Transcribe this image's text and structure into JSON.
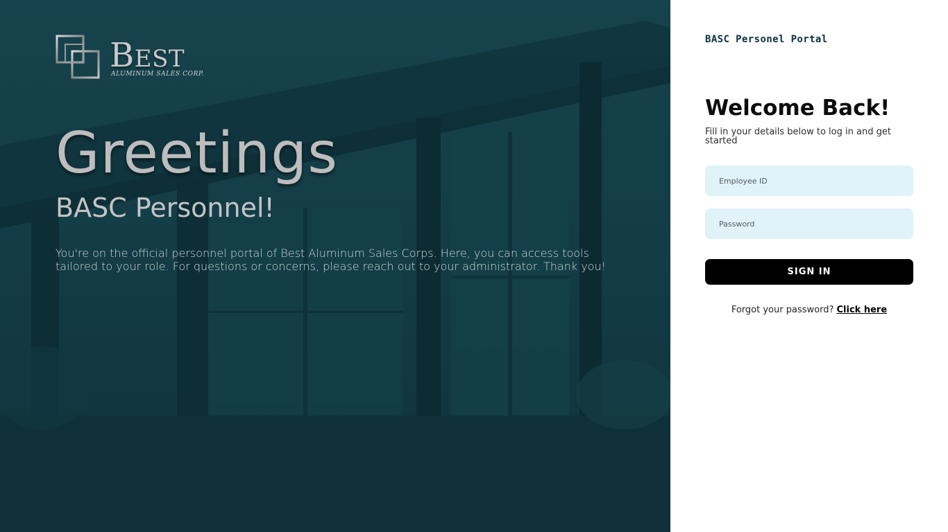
{
  "hero": {
    "logo": {
      "word_first": "B",
      "word_rest": "EST",
      "tagline": "ALUMINUM SALES CORP."
    },
    "greeting": "Greetings",
    "subgreeting": "BASC Personnel!",
    "intro": "You're on the official personnel portal of Best Aluminum Sales Corps. Here, you can access tools tailored to your role. For questions or concerns, please reach out to your administrator. Thank you!"
  },
  "login": {
    "portal_title": "BASC Personel Portal",
    "welcome": "Welcome Back!",
    "welcome_sub": "Fill in your details below to log in and get started",
    "employee_id_placeholder": "Employee ID",
    "employee_id_value": "",
    "password_placeholder": "Password",
    "password_value": "",
    "signin_label": "SIGN IN",
    "forgot_text": "Forgot your password?",
    "forgot_link": "Click here"
  },
  "colors": {
    "hero_bg": "#123d47",
    "field_bg": "#dff3f8",
    "button_bg": "#000000",
    "portal_title": "#0b3140"
  },
  "icons": {
    "logo_mark": "overlapping-squares-logo-icon"
  }
}
